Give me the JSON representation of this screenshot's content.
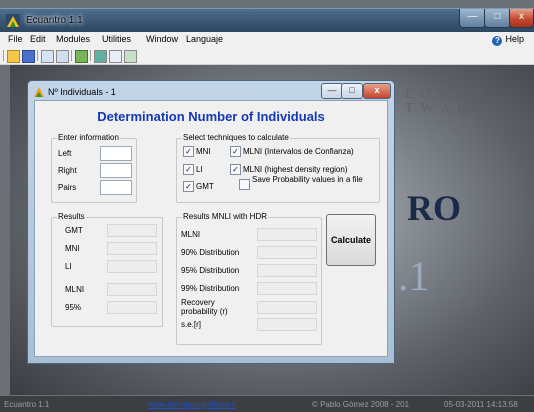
{
  "app": {
    "title": "Ecuantro 1.1",
    "icon": "app-icon",
    "window_controls": {
      "minimize": "—",
      "maximize": "□",
      "close": "x"
    }
  },
  "menubar": {
    "items": [
      "File",
      "Edit",
      "Modules",
      "Utilities",
      "Window",
      "Languaje"
    ],
    "help": "Help"
  },
  "toolbar": {
    "icons": [
      "open-folder-icon",
      "save-icon",
      "chart-icon",
      "copy-icon",
      "table-icon",
      "refresh-icon",
      "document-icon",
      "window-icon"
    ]
  },
  "background": {
    "brand_line1": "L O R O V",
    "brand_line2": "T W A R E",
    "big_text": "RO",
    "version_text": ".1"
  },
  "child_window": {
    "title": "Nº Individuals - 1",
    "controls": {
      "minimize": "—",
      "maximize": "□",
      "close": "x"
    },
    "heading": "Determination Number of Individuals",
    "enter_info": {
      "title": "Enter information",
      "fields": [
        {
          "label": "Left",
          "value": ""
        },
        {
          "label": "Right",
          "value": ""
        },
        {
          "label": "Pairs",
          "value": ""
        }
      ]
    },
    "techniques": {
      "title": "Select techniques to calculate",
      "options": [
        {
          "label": "MNI",
          "checked": true
        },
        {
          "label": "LI",
          "checked": true
        },
        {
          "label": "GMT",
          "checked": true
        },
        {
          "label": "MLNI (Intervalos de Confianza)",
          "checked": true
        },
        {
          "label": "MLNI (highest density region)",
          "checked": true
        },
        {
          "label": "Save Probability values in a file",
          "checked": false
        }
      ]
    },
    "results": {
      "title": "Results",
      "rows": [
        {
          "label": "GMT",
          "value": ""
        },
        {
          "label": "MNI",
          "value": ""
        },
        {
          "label": "LI",
          "value": ""
        },
        {
          "label": "MLNI",
          "value": ""
        },
        {
          "label": "95%",
          "value": ""
        }
      ]
    },
    "results_hdr": {
      "title": "Results MNLI with HDR",
      "rows": [
        {
          "label": "MLNI",
          "value": ""
        },
        {
          "label": "90% Distribution",
          "value": ""
        },
        {
          "label": "95% Distribution",
          "value": ""
        },
        {
          "label": "99% Distribution",
          "value": ""
        },
        {
          "label": "Recovery probability (r)",
          "value": ""
        },
        {
          "label": "s.e.[r]",
          "value": ""
        }
      ]
    },
    "calculate_label": "Calculate"
  },
  "statusbar": {
    "app": "Ecuantro 1.1",
    "link": "www.antropologiafisica.c",
    "copyright": "© Pablo Gómez 2008 - 201",
    "datetime": "05-03-2011 14:13:58"
  },
  "colors": {
    "heading": "#1537b8",
    "link": "#1e4fc8"
  }
}
